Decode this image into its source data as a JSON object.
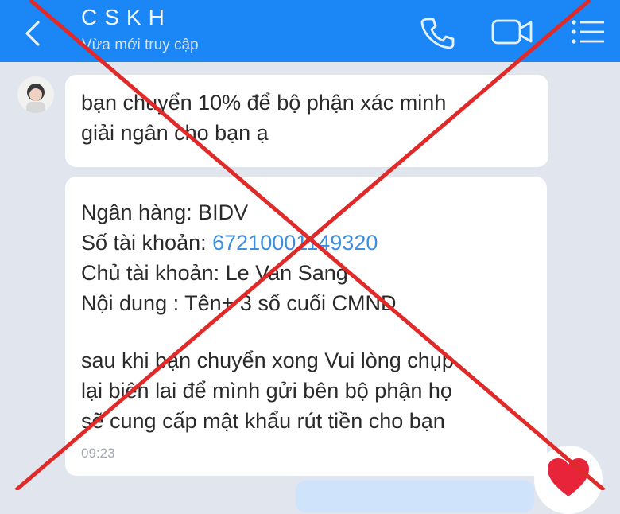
{
  "header": {
    "title": "CSKH",
    "status": "Vừa mới truy cập",
    "back_icon": "chevron-left-icon",
    "call_icon": "phone-icon",
    "video_icon": "video-camera-icon",
    "menu_icon": "list-menu-icon"
  },
  "messages": [
    {
      "lines": [
        "bạn chuyển  10% để  bộ phận xác minh",
        "giải ngân cho  bạn ạ"
      ]
    },
    {
      "bank_label": "Ngân hàng: ",
      "bank_value": "BIDV",
      "account_label": "Số tài khoản: ",
      "account_value": "67210001149320",
      "holder_label": "Chủ tài khoản:  ",
      "holder_value": " Le Van Sang",
      "content_line": "Nội dung : Tên+  3 số cuối CMND",
      "note_lines": [
        "sau khi bạn chuyển xong Vui lòng chụp",
        "lại biên lai để mình gửi bên bộ phận họ",
        "sẽ cung cấp mật khẩu rút tiền cho bạn"
      ],
      "time": "09:23"
    }
  ],
  "reaction": {
    "icon": "heart-icon"
  },
  "colors": {
    "header": "#1b86f5",
    "background": "#e1e5ee",
    "account_link": "#3d8ee0",
    "cross_mark": "#e02a2a"
  }
}
